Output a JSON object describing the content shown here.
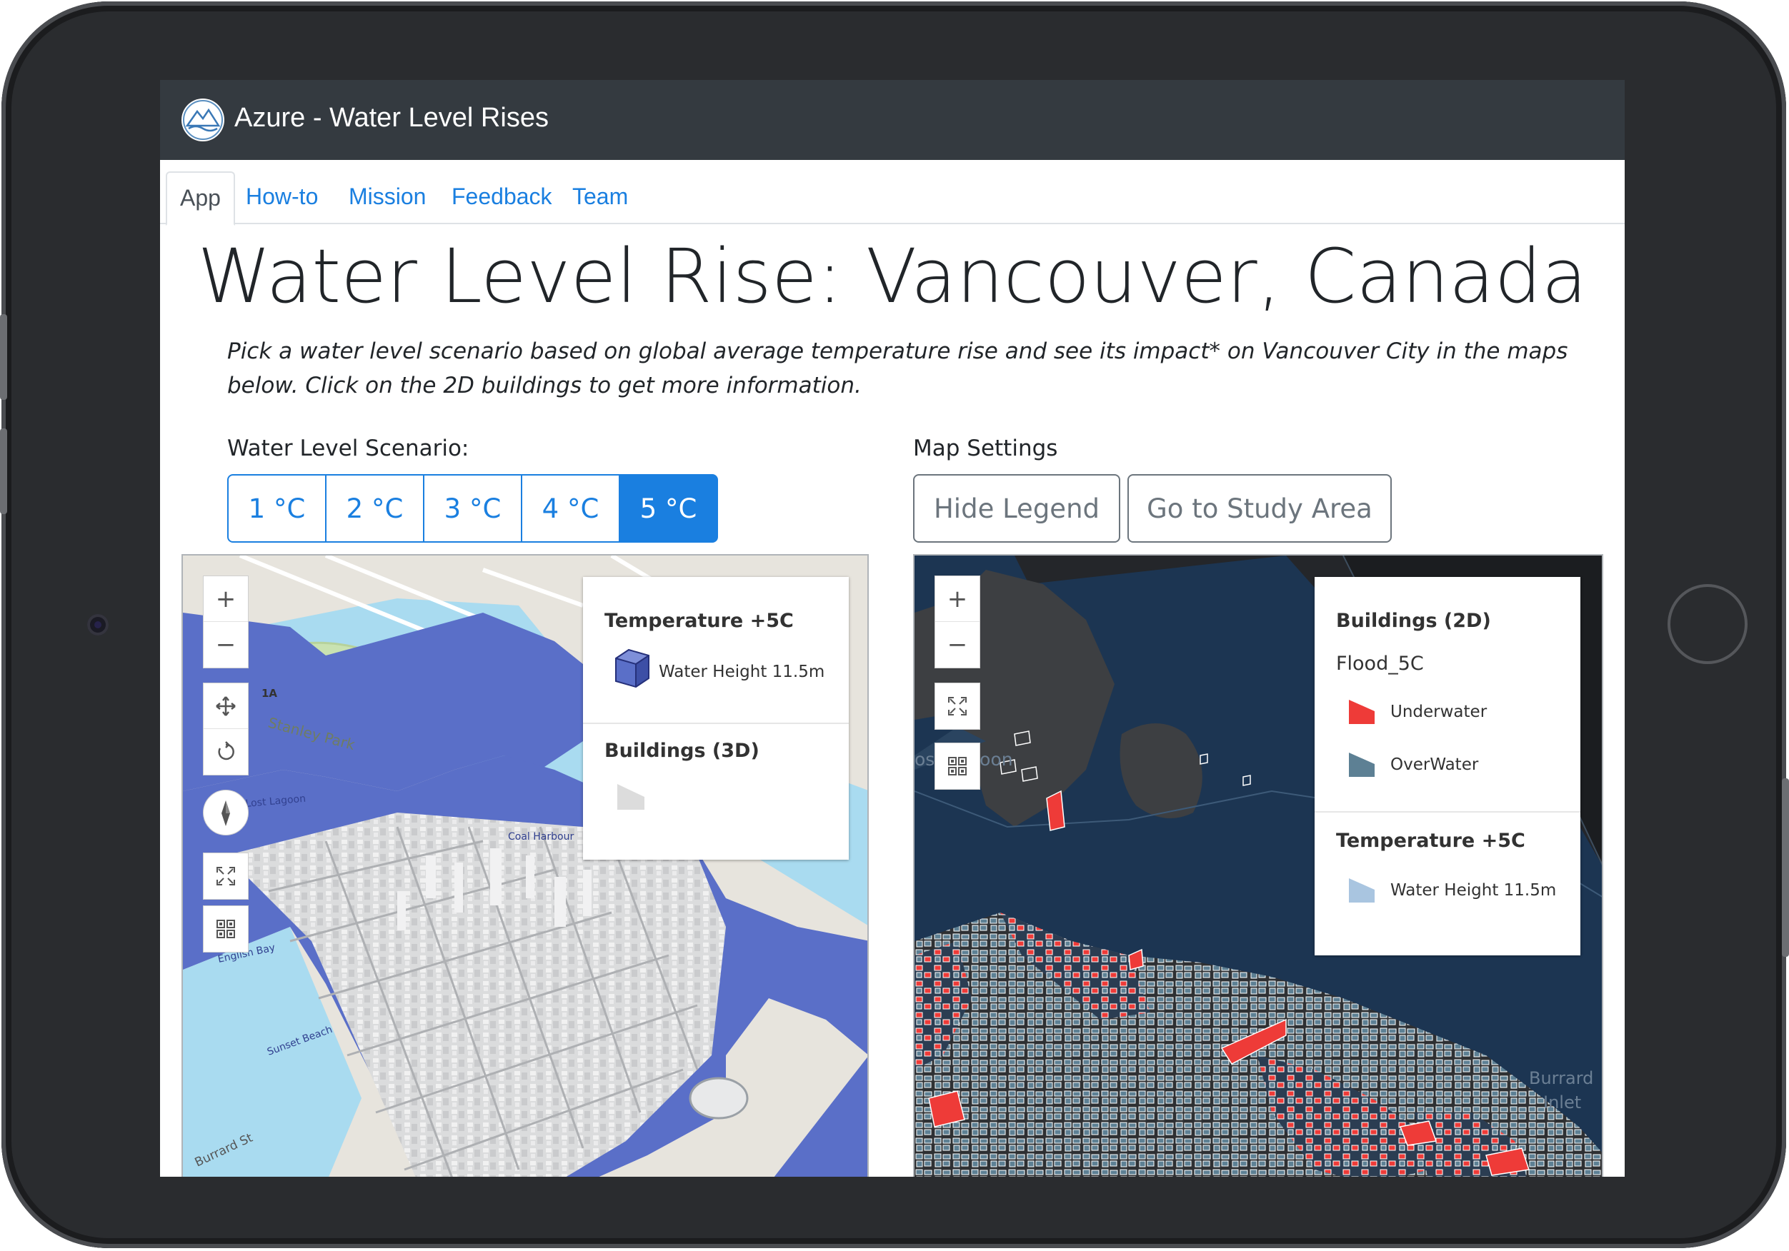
{
  "app": {
    "title": "Azure - Water Level Rises"
  },
  "tabs": [
    {
      "label": "App",
      "active": true
    },
    {
      "label": "How-to"
    },
    {
      "label": "Mission"
    },
    {
      "label": "Feedback"
    },
    {
      "label": "Team"
    }
  ],
  "page": {
    "title": "Water Level Rise: Vancouver, Canada",
    "intro": "Pick a water level scenario based on global average temperature rise and see its impact* on Vancouver City in the maps below. Click on the 2D buildings to get more information."
  },
  "scenario": {
    "label": "Water Level Scenario:",
    "options": [
      "1 °C",
      "2 °C",
      "3 °C",
      "4 °C",
      "5 °C"
    ],
    "selected": "5 °C"
  },
  "settings": {
    "label": "Map Settings",
    "hide_legend": "Hide Legend",
    "go_study_area": "Go to Study Area"
  },
  "map3d": {
    "zoom_in": "+",
    "zoom_out": "−",
    "legend": {
      "temp_title": "Temperature +5C",
      "water_label": "Water Height 11.5m",
      "buildings_title": "Buildings (3D)"
    },
    "place_labels": [
      "Stanley Park",
      "1A",
      "Lost Lagoon",
      "Coal Harbour",
      "Burrard St",
      "English Bay",
      "Sunset Beach"
    ]
  },
  "map2d": {
    "zoom_in": "+",
    "zoom_out": "−",
    "legend": {
      "buildings_title": "Buildings (2D)",
      "flood_layer": "Flood_5C",
      "underwater_label": "Underwater",
      "overwater_label": "OverWater",
      "temp_title": "Temperature +5C",
      "water_label": "Water Height 11.5m"
    },
    "place_labels": [
      "ost Lagoon",
      "Burrard",
      "Inlet"
    ]
  },
  "colors": {
    "navbar": "#343a40",
    "primary": "#1a7fe0",
    "flood_3d": "#5a6fc8",
    "flood_2d": "#1c3552",
    "underwater": "#ee3b38",
    "overwater": "#5d8094",
    "water_height_legend": "#a9c5e0"
  }
}
